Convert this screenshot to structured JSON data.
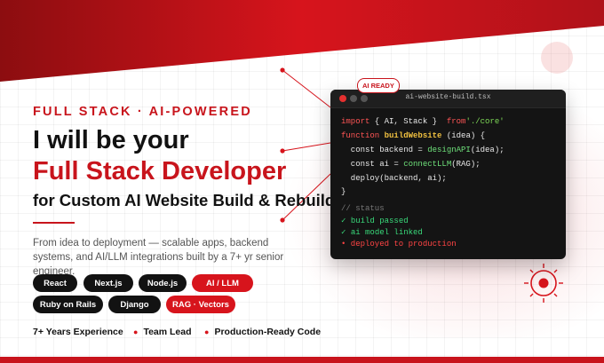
{
  "colors": {
    "accent": "#c8141c",
    "dark": "#121212",
    "code_bg": "#141414"
  },
  "hero": {
    "eyebrow": "FULL STACK · AI-POWERED",
    "headline_line1": "I will be your",
    "headline_line2": "Full Stack Developer",
    "subheadline": "for Custom AI Website Build & Rebuild",
    "description": "From idea to deployment — scalable apps, backend systems, and AI/LLM integrations built by a 7+ yr senior engineer."
  },
  "tags": [
    {
      "label": "React",
      "highlight": false
    },
    {
      "label": "Next.js",
      "highlight": false
    },
    {
      "label": "Node.js",
      "highlight": false
    },
    {
      "label": "AI / LLM",
      "highlight": true
    },
    {
      "label": "Ruby on Rails",
      "highlight": false
    },
    {
      "label": "Django",
      "highlight": false
    },
    {
      "label": "RAG · Vectors",
      "highlight": true
    }
  ],
  "stats": [
    "7+ Years Experience",
    "Team Lead",
    "Production-Ready Code"
  ],
  "editor": {
    "badge": "AI READY",
    "filename": "ai-website-build.tsx",
    "line1_kw": "import",
    "line1_names": " { AI, Stack } ",
    "line1_from": " from",
    "line1_path": "'./core'",
    "line2_kw": "function",
    "line2_fn": " buildWebsite",
    "line2_args": " (idea) {",
    "line3_pre": "  const backend = ",
    "line3_call": "designAPI",
    "line3_post": "(idea);",
    "line4_pre": "  const ai = ",
    "line4_call": "connectLLM",
    "line4_post": "(RAG);",
    "line5": "  deploy(backend, ai);",
    "line6": "}",
    "comment": "// status",
    "status": [
      {
        "text": "✓ build passed",
        "state": "ok"
      },
      {
        "text": "✓ ai model linked",
        "state": "ok"
      },
      {
        "text": "• deployed to production",
        "state": "bad"
      }
    ]
  }
}
